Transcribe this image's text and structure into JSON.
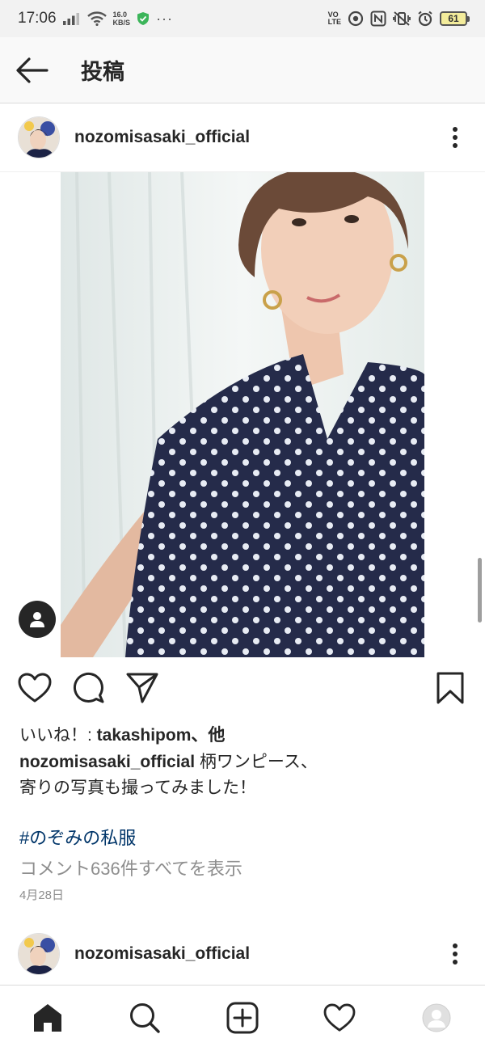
{
  "status_bar": {
    "time": "17:06",
    "net_speed_value": "16.0",
    "net_speed_unit": "KB/S",
    "overflow_dots": "···",
    "volte_top": "VO",
    "volte_bottom": "LTE",
    "battery_level": "61"
  },
  "header": {
    "title": "投稿"
  },
  "post": {
    "username": "nozomisasaki_official",
    "likes_prefix": "いいね！: ",
    "likes_user": "takashipom",
    "likes_suffix": "、他",
    "caption_user": "nozomisasaki_official",
    "caption_line1": " 柄ワンピース、",
    "caption_line2": "寄りの写真も撮ってみました！",
    "hashtag": "#のぞみの私服",
    "comments_link": "コメント636件すべてを表示",
    "date": "4月28日"
  },
  "next_post": {
    "username": "nozomisasaki_official"
  },
  "icons": {
    "back": "arrow-left-icon",
    "more": "more-vertical-icon",
    "like": "heart-icon",
    "comment": "comment-icon",
    "share": "send-icon",
    "save": "bookmark-icon",
    "tag": "person-tag-icon",
    "home": "home-icon",
    "search": "search-icon",
    "new_post": "plus-square-icon",
    "activity": "heart-icon",
    "profile": "profile-avatar-icon"
  },
  "colors": {
    "text": "#262626",
    "secondary_text": "#8e8e8e",
    "hashtag": "#003569",
    "border": "#dbdbdb"
  }
}
